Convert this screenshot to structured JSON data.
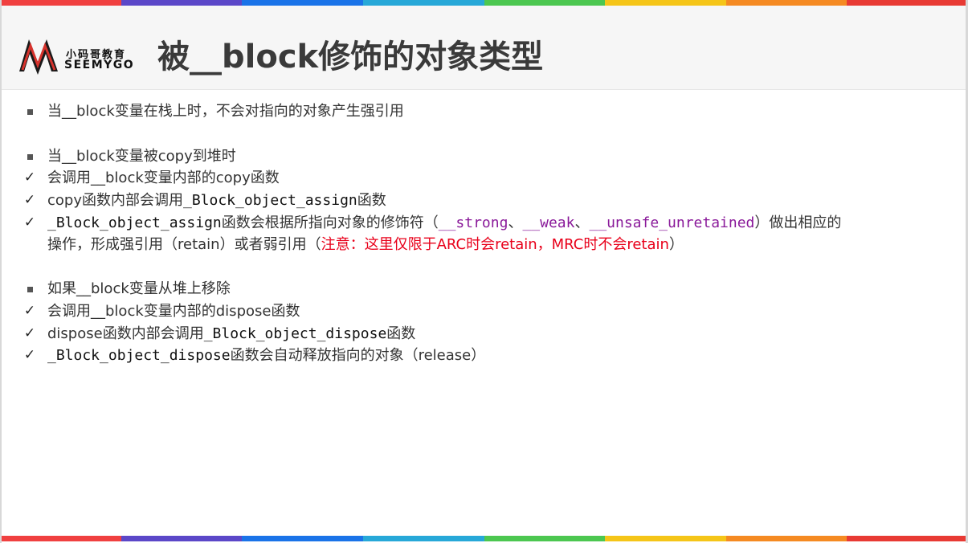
{
  "header": {
    "logo_cn": "小码哥教育",
    "logo_en": "SEEMYGO",
    "title": "被__block修饰的对象类型"
  },
  "colors": {
    "rainbow": [
      "#f04040",
      "#5b47c8",
      "#1a73e8",
      "#27a8d8",
      "#4cc750",
      "#f5c518",
      "#f58a22",
      "#e83a34"
    ],
    "keyword_purple": "#8a1a9a",
    "note_red": "#e8001a"
  },
  "items": [
    {
      "marker": "square",
      "parts": [
        {
          "t": "当__block变量在栈上时，不会对指向的对象产生强引用"
        }
      ]
    },
    {
      "marker": "square",
      "parts": [
        {
          "t": "当__block变量被copy到堆时"
        }
      ]
    },
    {
      "marker": "check",
      "parts": [
        {
          "t": "会调用__block变量内部的copy函数"
        }
      ]
    },
    {
      "marker": "check",
      "parts": [
        {
          "t": "copy函数内部会调用"
        },
        {
          "t": "_Block_object_assign",
          "s": "mono"
        },
        {
          "t": "函数"
        }
      ]
    },
    {
      "marker": "check",
      "parts": [
        {
          "t": "_Block_object_assign",
          "s": "mono"
        },
        {
          "t": "函数会根据所指向对象的修饰符（"
        },
        {
          "t": "__strong",
          "s": "purple"
        },
        {
          "t": "、"
        },
        {
          "t": "__weak",
          "s": "purple"
        },
        {
          "t": "、"
        },
        {
          "t": "__unsafe_unretained",
          "s": "purple"
        },
        {
          "t": "）做出相应的"
        }
      ]
    },
    {
      "marker": "none",
      "parts": [
        {
          "t": "操作，形成强引用（retain）或者弱引用（"
        },
        {
          "t": "注意：这里仅限于ARC时会retain，MRC时不会retain",
          "s": "red"
        },
        {
          "t": "）"
        }
      ]
    },
    {
      "marker": "square",
      "parts": [
        {
          "t": "如果__block变量从堆上移除"
        }
      ]
    },
    {
      "marker": "check",
      "parts": [
        {
          "t": "会调用__block变量内部的dispose函数"
        }
      ]
    },
    {
      "marker": "check",
      "parts": [
        {
          "t": "dispose函数内部会调用"
        },
        {
          "t": "_Block_object_dispose",
          "s": "mono"
        },
        {
          "t": "函数"
        }
      ]
    },
    {
      "marker": "check",
      "parts": [
        {
          "t": "_Block_object_dispose",
          "s": "mono"
        },
        {
          "t": "函数会自动释放指向的对象（release）"
        }
      ]
    }
  ]
}
